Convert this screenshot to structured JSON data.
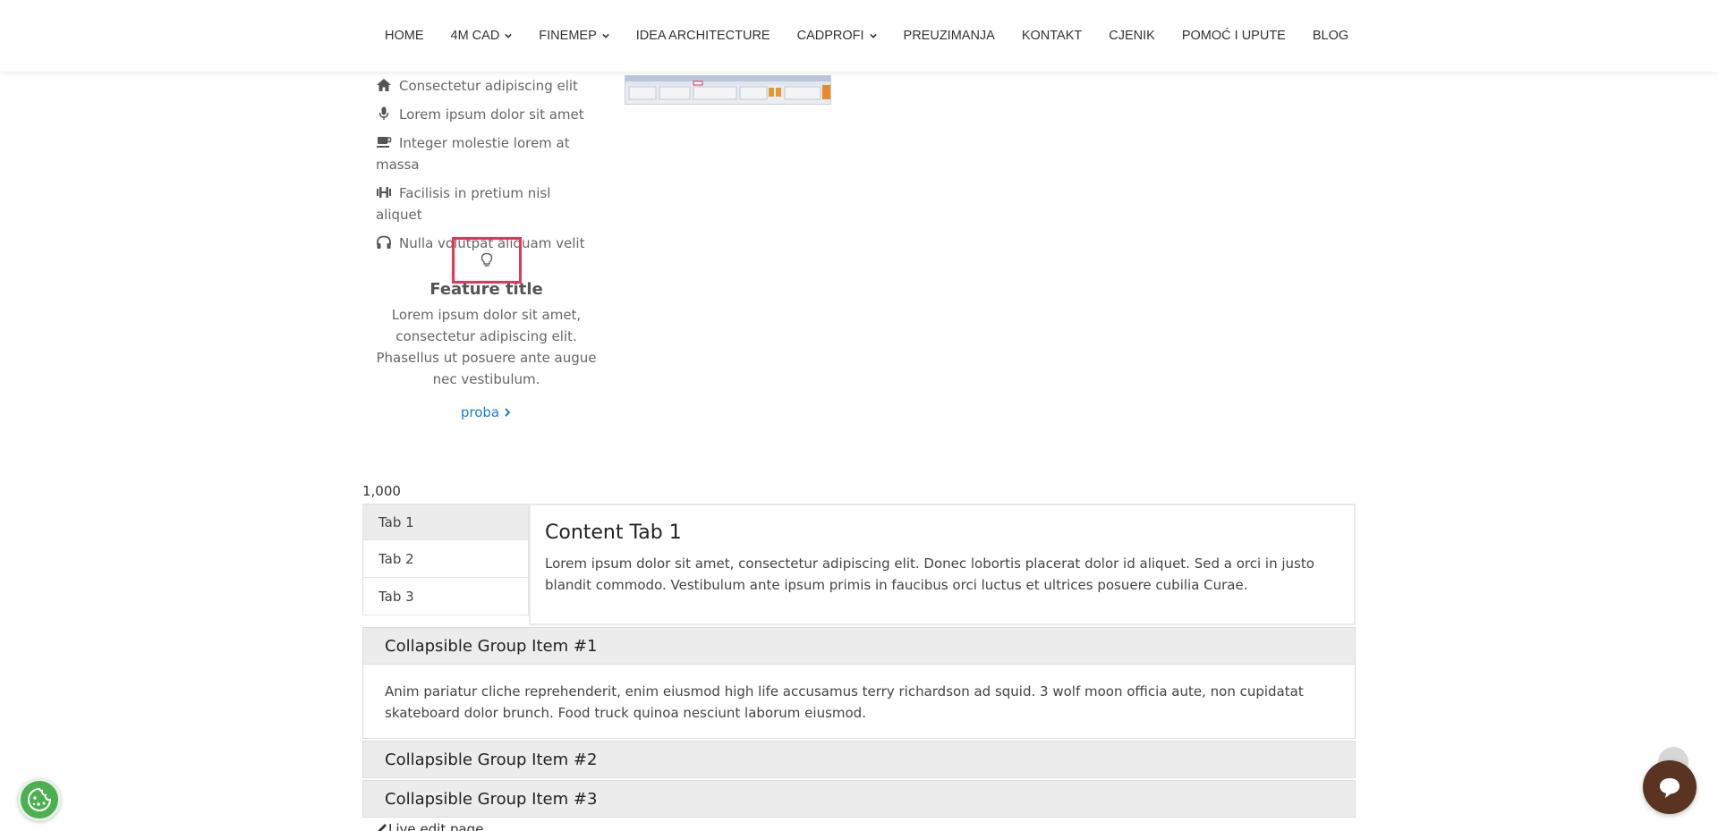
{
  "nav": {
    "items": [
      {
        "label": "HOME",
        "dropdown": false
      },
      {
        "label": "4M CAD",
        "dropdown": true
      },
      {
        "label": "FINEMEP",
        "dropdown": true
      },
      {
        "label": "IDEA ARCHITECTURE",
        "dropdown": false
      },
      {
        "label": "CADPROFI",
        "dropdown": true
      },
      {
        "label": "PREUZIMANJA",
        "dropdown": false
      },
      {
        "label": "KONTAKT",
        "dropdown": false
      },
      {
        "label": "CJENIK",
        "dropdown": false
      },
      {
        "label": "POMOĆ I UPUTE",
        "dropdown": false
      },
      {
        "label": "BLOG",
        "dropdown": false
      }
    ]
  },
  "icon_list": [
    {
      "icon": "home-icon",
      "text": "Consectetur adipiscing elit"
    },
    {
      "icon": "microphone-icon",
      "text": "Lorem ipsum dolor sit amet"
    },
    {
      "icon": "coffee-icon",
      "text": "Integer molestie lorem at massa"
    },
    {
      "icon": "dumbbell-icon",
      "text": "Facilisis in pretium nisl aliquet"
    },
    {
      "icon": "headphones-icon",
      "text": "Nulla volutpat aliquam velit"
    }
  ],
  "feature": {
    "icon": "lightbulb-icon",
    "title": "Feature title",
    "text": "Lorem ipsum dolor sit amet, consectetur adipiscing elit. Phasellus ut posuere ante augue nec vestibulum.",
    "link_label": "proba"
  },
  "counter": "1,000",
  "tabs": {
    "items": [
      "Tab 1",
      "Tab 2",
      "Tab 3"
    ],
    "active_index": 0,
    "content_title": "Content Tab 1",
    "content_text": "Lorem ipsum dolor sit amet, consectetur adipiscing elit. Donec lobortis placerat dolor id aliquet. Sed a orci in justo blandit commodo. Vestibulum ante ipsum primis in faucibus orci luctus et ultrices posuere cubilia Curae."
  },
  "accordion": {
    "items": [
      {
        "title": "Collapsible Group Item #1",
        "body": "Anim pariatur cliche reprehenderit, enim eiusmod high life accusamus terry richardson ad squid. 3 wolf moon officia aute, non cupidatat skateboard dolor brunch. Food truck quinoa nesciunt laborum eiusmod.",
        "expanded": true
      },
      {
        "title": "Collapsible Group Item #2",
        "expanded": false
      },
      {
        "title": "Collapsible Group Item #3",
        "expanded": false
      }
    ]
  },
  "live_edit": "Live edit page",
  "colors": {
    "accent_link": "#1a7fd1",
    "highlight_border": "#e8335a",
    "chat_button": "#5a3321",
    "cookie_button": "#4caf50"
  }
}
